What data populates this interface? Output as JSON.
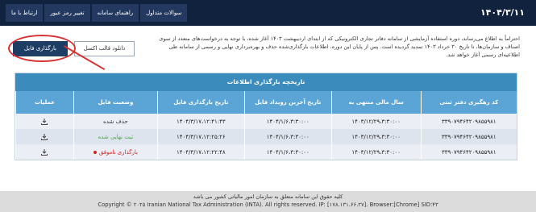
{
  "header": {
    "date": "۱۴۰۴/۳/۱۱",
    "nav": [
      {
        "label": "ارتباط با ما",
        "name": "nav-contact"
      },
      {
        "label": "تغییر رمز عبور",
        "name": "nav-change-password"
      },
      {
        "label": "راهنمای سامانه",
        "name": "nav-guide"
      },
      {
        "label": "سوالات متداول",
        "name": "nav-faq"
      }
    ]
  },
  "intro": {
    "text": "احتراماً به اطلاع می‌رساند، دوره استفاده آزمایشی از سامانه دفاتر تجاری الکترونیکی که از ابتدای اردیبهشت ۱۴۰۳ آغاز شده، با توجه به درخواست‌های متعدد از سوی اصناف و سازمان‌ها، تا تاریخ ۳۰ خرداد ۱۴۰۳ تمدید گردیده است. پس از پایان این دوره، اطلاعات بارگذاری‌شده حذف و بهره‌برداری نهایی و رسمی از سامانه طی اطلاعیه‌ای رسمی آغاز خواهد شد."
  },
  "actions": {
    "upload_label": "بارگذاری فایل",
    "template_label": "دانلود قالب اکسل"
  },
  "history": {
    "title": "تاریخچه بارگذاری اطلاعات",
    "columns": [
      "کد رهگیری دفتر ثبتی",
      "سال مالی منتهی به",
      "تاریخ آخرین رویداد فایل",
      "تاریخ بارگذاری فایل",
      "وضعیت فایل",
      "عملیات"
    ],
    "rows": [
      {
        "code": "۳۳۹۰۷۹۴۶۴۲۰۹۸۵۵۹۸۱",
        "fiscal": "۱۴۰۳/۱۲/۲۹،۳:۳۰:۰۰",
        "last_event": "۱۴۰۴/۱/۶،۳:۳۰:۰۰",
        "upload_date": "۱۴۰۴/۳/۱۷،۱۲:۴۱:۴۳",
        "status": "حذف شده",
        "status_kind": "deleted"
      },
      {
        "code": "۳۳۹۰۷۹۴۶۴۲۰۹۸۵۵۹۸۱",
        "fiscal": "۱۴۰۳/۱۲/۲۹،۳:۳۰:۰۰",
        "last_event": "۱۴۰۴/۱/۶،۳:۳۰:۰۰",
        "upload_date": "۱۴۰۴/۳/۱۷،۱۲:۲۵:۲۶",
        "status": "ثبت نهایی شده",
        "status_kind": "done"
      },
      {
        "code": "۳۳۹۰۷۹۴۶۴۲۰۹۸۵۵۹۸۱",
        "fiscal": "۱۴۰۳/۱۲/۲۹،۳:۳۰:۰۰",
        "last_event": "۱۴۰۴/۱/۶،۳:۳۰:۰۰",
        "upload_date": "۱۴۰۴/۳/۱۷،۱۲:۲۲:۴۸",
        "status": "بارگذاری ناموفق",
        "status_kind": "failed"
      }
    ]
  },
  "footer": {
    "line1": "کلیه حقوق این سامانه متعلق به سازمان امور مالیاتی کشور می باشد",
    "line2": "Copyright © ۲۰۲۵ Iranian National Tax Administration (INTA). All rights reserved. IP: [۱۷۸.۱۳۱.۶۶.۲۷]. Browser:[Chrome] SID:۴۳"
  },
  "colors": {
    "topbar": "#11223f",
    "panel_header": "#3b8bbd",
    "table_header": "#5ba4d6",
    "status_done": "#4aa54a",
    "status_failed": "#d21f1f",
    "annotation": "#d83232"
  }
}
